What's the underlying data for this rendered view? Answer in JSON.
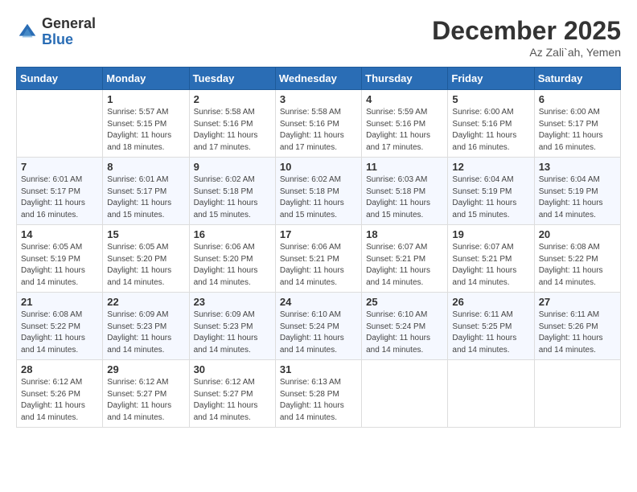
{
  "header": {
    "logo_general": "General",
    "logo_blue": "Blue",
    "month_title": "December 2025",
    "location": "Az Zali`ah, Yemen"
  },
  "calendar": {
    "days_of_week": [
      "Sunday",
      "Monday",
      "Tuesday",
      "Wednesday",
      "Thursday",
      "Friday",
      "Saturday"
    ],
    "weeks": [
      [
        {
          "day": "",
          "info": ""
        },
        {
          "day": "1",
          "info": "Sunrise: 5:57 AM\nSunset: 5:15 PM\nDaylight: 11 hours and 18 minutes."
        },
        {
          "day": "2",
          "info": "Sunrise: 5:58 AM\nSunset: 5:16 PM\nDaylight: 11 hours and 17 minutes."
        },
        {
          "day": "3",
          "info": "Sunrise: 5:58 AM\nSunset: 5:16 PM\nDaylight: 11 hours and 17 minutes."
        },
        {
          "day": "4",
          "info": "Sunrise: 5:59 AM\nSunset: 5:16 PM\nDaylight: 11 hours and 17 minutes."
        },
        {
          "day": "5",
          "info": "Sunrise: 6:00 AM\nSunset: 5:16 PM\nDaylight: 11 hours and 16 minutes."
        },
        {
          "day": "6",
          "info": "Sunrise: 6:00 AM\nSunset: 5:17 PM\nDaylight: 11 hours and 16 minutes."
        }
      ],
      [
        {
          "day": "7",
          "info": "Sunrise: 6:01 AM\nSunset: 5:17 PM\nDaylight: 11 hours and 16 minutes."
        },
        {
          "day": "8",
          "info": "Sunrise: 6:01 AM\nSunset: 5:17 PM\nDaylight: 11 hours and 15 minutes."
        },
        {
          "day": "9",
          "info": "Sunrise: 6:02 AM\nSunset: 5:18 PM\nDaylight: 11 hours and 15 minutes."
        },
        {
          "day": "10",
          "info": "Sunrise: 6:02 AM\nSunset: 5:18 PM\nDaylight: 11 hours and 15 minutes."
        },
        {
          "day": "11",
          "info": "Sunrise: 6:03 AM\nSunset: 5:18 PM\nDaylight: 11 hours and 15 minutes."
        },
        {
          "day": "12",
          "info": "Sunrise: 6:04 AM\nSunset: 5:19 PM\nDaylight: 11 hours and 15 minutes."
        },
        {
          "day": "13",
          "info": "Sunrise: 6:04 AM\nSunset: 5:19 PM\nDaylight: 11 hours and 14 minutes."
        }
      ],
      [
        {
          "day": "14",
          "info": "Sunrise: 6:05 AM\nSunset: 5:19 PM\nDaylight: 11 hours and 14 minutes."
        },
        {
          "day": "15",
          "info": "Sunrise: 6:05 AM\nSunset: 5:20 PM\nDaylight: 11 hours and 14 minutes."
        },
        {
          "day": "16",
          "info": "Sunrise: 6:06 AM\nSunset: 5:20 PM\nDaylight: 11 hours and 14 minutes."
        },
        {
          "day": "17",
          "info": "Sunrise: 6:06 AM\nSunset: 5:21 PM\nDaylight: 11 hours and 14 minutes."
        },
        {
          "day": "18",
          "info": "Sunrise: 6:07 AM\nSunset: 5:21 PM\nDaylight: 11 hours and 14 minutes."
        },
        {
          "day": "19",
          "info": "Sunrise: 6:07 AM\nSunset: 5:21 PM\nDaylight: 11 hours and 14 minutes."
        },
        {
          "day": "20",
          "info": "Sunrise: 6:08 AM\nSunset: 5:22 PM\nDaylight: 11 hours and 14 minutes."
        }
      ],
      [
        {
          "day": "21",
          "info": "Sunrise: 6:08 AM\nSunset: 5:22 PM\nDaylight: 11 hours and 14 minutes."
        },
        {
          "day": "22",
          "info": "Sunrise: 6:09 AM\nSunset: 5:23 PM\nDaylight: 11 hours and 14 minutes."
        },
        {
          "day": "23",
          "info": "Sunrise: 6:09 AM\nSunset: 5:23 PM\nDaylight: 11 hours and 14 minutes."
        },
        {
          "day": "24",
          "info": "Sunrise: 6:10 AM\nSunset: 5:24 PM\nDaylight: 11 hours and 14 minutes."
        },
        {
          "day": "25",
          "info": "Sunrise: 6:10 AM\nSunset: 5:24 PM\nDaylight: 11 hours and 14 minutes."
        },
        {
          "day": "26",
          "info": "Sunrise: 6:11 AM\nSunset: 5:25 PM\nDaylight: 11 hours and 14 minutes."
        },
        {
          "day": "27",
          "info": "Sunrise: 6:11 AM\nSunset: 5:26 PM\nDaylight: 11 hours and 14 minutes."
        }
      ],
      [
        {
          "day": "28",
          "info": "Sunrise: 6:12 AM\nSunset: 5:26 PM\nDaylight: 11 hours and 14 minutes."
        },
        {
          "day": "29",
          "info": "Sunrise: 6:12 AM\nSunset: 5:27 PM\nDaylight: 11 hours and 14 minutes."
        },
        {
          "day": "30",
          "info": "Sunrise: 6:12 AM\nSunset: 5:27 PM\nDaylight: 11 hours and 14 minutes."
        },
        {
          "day": "31",
          "info": "Sunrise: 6:13 AM\nSunset: 5:28 PM\nDaylight: 11 hours and 14 minutes."
        },
        {
          "day": "",
          "info": ""
        },
        {
          "day": "",
          "info": ""
        },
        {
          "day": "",
          "info": ""
        }
      ]
    ]
  }
}
